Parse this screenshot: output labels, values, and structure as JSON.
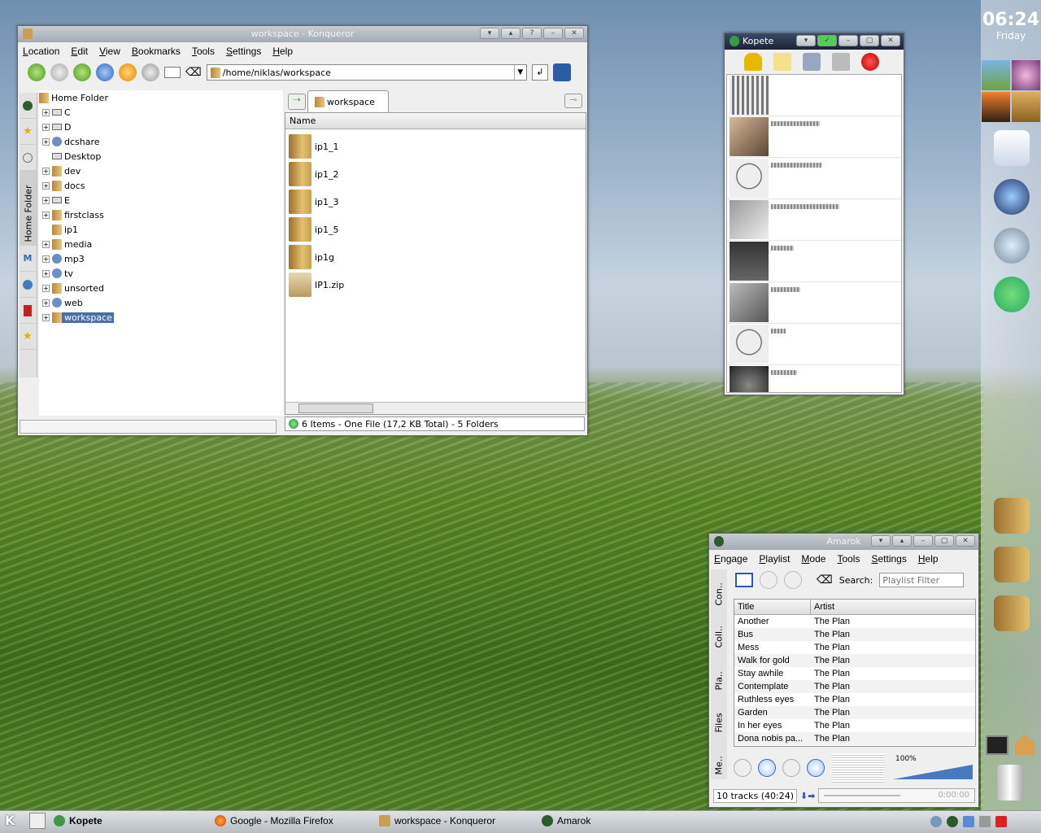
{
  "konqueror": {
    "title": "workspace - Konqueror",
    "menu": [
      "Location",
      "Edit",
      "View",
      "Bookmarks",
      "Tools",
      "Settings",
      "Help"
    ],
    "location": "/home/niklas/workspace",
    "tree_root": "Home Folder",
    "tree": [
      "C",
      "D",
      "dcshare",
      "Desktop",
      "dev",
      "docs",
      "E",
      "firstclass",
      "ip1",
      "media",
      "mp3",
      "tv",
      "unsorted",
      "web",
      "workspace"
    ],
    "side_tab": "Home Folder",
    "tab": "workspace",
    "col_name": "Name",
    "files": [
      "ip1_1",
      "ip1_2",
      "ip1_3",
      "ip1_5",
      "ip1g",
      "IP1.zip"
    ],
    "status": "6 Items - One File (17,2 KB Total) - 5 Folders"
  },
  "kopete": {
    "title": "Kopete"
  },
  "amarok": {
    "title": "Amarok",
    "menu": [
      "Engage",
      "Playlist",
      "Mode",
      "Tools",
      "Settings",
      "Help"
    ],
    "search_label": "Search:",
    "search_placeholder": "Playlist Filter",
    "col_title": "Title",
    "col_artist": "Artist",
    "tracks": [
      {
        "t": "Another",
        "a": "The Plan"
      },
      {
        "t": "Bus",
        "a": "The Plan"
      },
      {
        "t": "Mess",
        "a": "The Plan"
      },
      {
        "t": "Walk for gold",
        "a": "The Plan"
      },
      {
        "t": "Stay awhile",
        "a": "The Plan"
      },
      {
        "t": "Contemplate",
        "a": "The Plan"
      },
      {
        "t": "Ruthless eyes",
        "a": "The Plan"
      },
      {
        "t": "Garden",
        "a": "The Plan"
      },
      {
        "t": "In her eyes",
        "a": "The Plan"
      },
      {
        "t": "Dona nobis pa...",
        "a": "The Plan"
      }
    ],
    "side_tabs": [
      "Con..",
      "Coll..",
      "Pla..",
      "Files",
      "Me.."
    ],
    "volume": "100%",
    "status": "10 tracks (40:24)",
    "time": "0:00:00"
  },
  "clock": {
    "time": "06:24",
    "day": "Friday"
  },
  "taskbar": {
    "items": [
      "Kopete",
      "Google - Mozilla Firefox",
      "workspace - Konqueror",
      "Amarok"
    ]
  }
}
